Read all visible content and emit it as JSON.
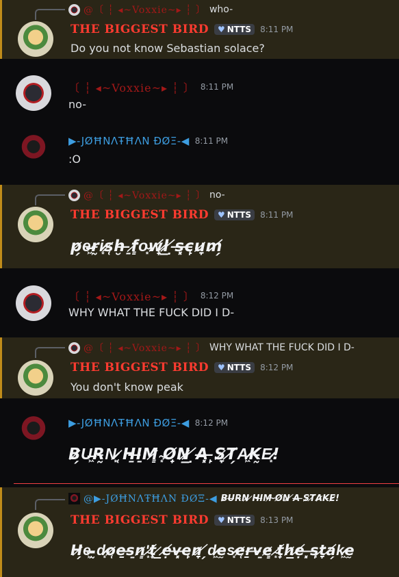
{
  "users": {
    "bird": "THE BIGGEST BIRD",
    "voxxie": "〔 ┆ ◂~Voxxie~▸ ┆ 〕",
    "johnathan": "▶-JØĦNΛŦĦΛN ĐØΞ-◀",
    "voxxie_reply": "@〔 ┆ ◂~Voxxie~▸ ┆ 〕",
    "johnathan_reply": "@▶-JØĦNΛŦĦΛN ĐØΞ-◀"
  },
  "badge_label": "NTTS",
  "messages": [
    {
      "time": "8:11 PM",
      "reply_text": "who-",
      "content": "Do you not know Sebastian solace?"
    },
    {
      "time": "8:11 PM",
      "content": "no-"
    },
    {
      "time": "8:11 PM",
      "content": ":O"
    },
    {
      "time": "8:11 PM",
      "reply_text": "no-",
      "content": "p̷̗e̶͖r̵̰i̷͙s̷̜ḫ̵ ̶̠f̷͇o̴͙w̸̟l̷̲ ̸̣s̶͓c̶̙u̷̞m̸̗"
    },
    {
      "time": "8:12 PM",
      "content": "WHY WHAT THE FUCK DID I D-"
    },
    {
      "time": "8:12 PM",
      "reply_text": "WHY WHAT THE FUCK DID I D-",
      "content": "You don't know peak"
    },
    {
      "time": "8:12 PM",
      "content": "B̷̗U̶͖R̵̰N̷͙ ̷̜H̵̱I̶̠M̷͇ ̴͙O̸̟N̷̲ ̸̣A̶͓ ̶̙S̷̞T̸̗A̷͖K̵̰E̷͙!"
    },
    {
      "time": "8:13 PM",
      "reply_text": "B̷U̶R̵N̷ ̷H̵I̶M̷ ̴O̸N̷ ̸A̶ ̶S̷T̸A̷K̵E̷!",
      "content": "H̷̗e̶͖ ̵̰d̷͙o̷̜e̵̱s̶̠n̷͇'̴͙t̸̟ ̷̲ẹ̸v̶͓e̶̙n̷̞ ̸̗d̷͖ḛ̵s̷͙e̷̜ṟ̵v̶̠e̷͇ ̴͙t̸̟h̷̲ẹ̸ ̶͓s̶̙t̷̞a̸̗k̷͖ḛ̵"
    }
  ],
  "colors": {
    "bird_name": "#ff3b30",
    "voxxie_name": "#a31818",
    "johnathan_name": "#3d9de0",
    "mention_bg": "#2a2617",
    "mention_bar": "#c08c1a",
    "new_separator": "#f23f43"
  }
}
